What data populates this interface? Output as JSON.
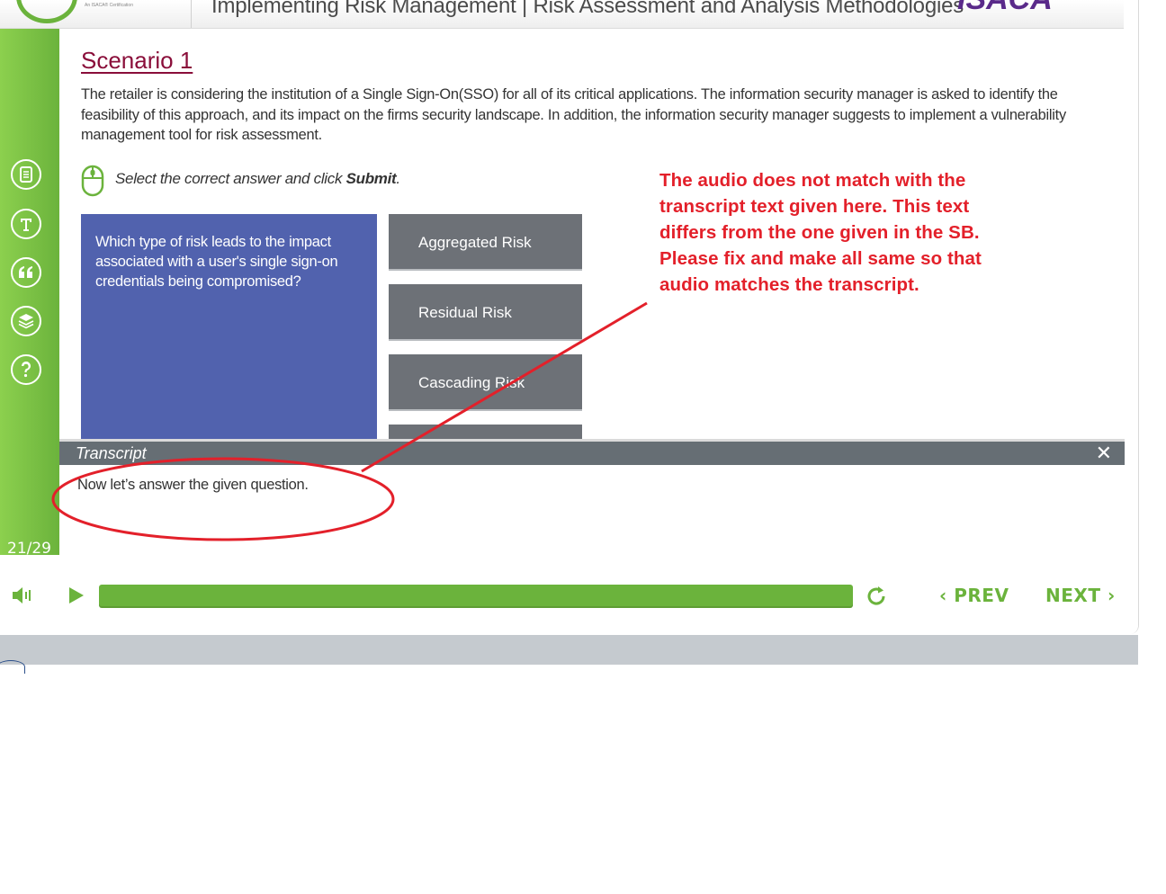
{
  "header": {
    "logo_subtext": "An ISACA® Certification",
    "course_title": "Implementing Risk Management | Risk Assessment and Analysis Methodologies",
    "brand": "ISACA"
  },
  "sidebar": {
    "icons": [
      "glossary-icon",
      "text-icon",
      "quote-icon",
      "resources-icon",
      "help-icon"
    ],
    "page_count": "21/29"
  },
  "scenario": {
    "title": "Scenario 1",
    "body": "The retailer is considering the institution of a Single Sign-On(SSO) for all of its critical applications. The information security manager is asked to identify the feasibility of this approach, and its impact on the firms security landscape. In addition, the information security manager suggests to implement a vulnerability management tool for risk assessment."
  },
  "instruction": {
    "prefix": "Select the correct answer and click ",
    "action": "Submit",
    "suffix": "."
  },
  "question": {
    "text": "Which type of risk leads to the impact associated with a user's single sign-on credentials being compromised?",
    "options": [
      "Aggregated Risk",
      "Residual Risk",
      "Cascading Risk"
    ]
  },
  "annotation": {
    "text": "The audio does not match with the transcript text given here. This text differs from the one given in the SB. Please fix and make all same so that audio matches the transcript.",
    "color": "#e3202a"
  },
  "transcript": {
    "label": "Transcript",
    "close": "✕",
    "text": "Now let’s answer the given question."
  },
  "controls": {
    "progress_fraction": 1.0,
    "prev_label": "PREV",
    "next_label": "NEXT",
    "accent": "#6bb33c"
  }
}
